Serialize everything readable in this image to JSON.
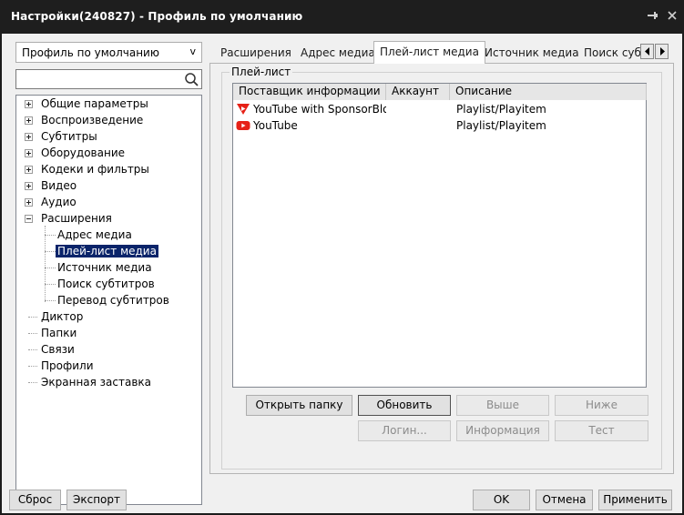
{
  "window": {
    "title": "Настройки(240827) - Профиль по умолчанию",
    "pin_icon": "pin-icon",
    "close_icon": "close-icon"
  },
  "sidebar": {
    "profile_select": {
      "value": "Профиль по умолчанию",
      "arrow": "v"
    },
    "search": {
      "placeholder": "",
      "value": "",
      "icon": "search-icon"
    },
    "tree": [
      {
        "label": "Общие параметры",
        "level": 0,
        "expander": "plus"
      },
      {
        "label": "Воспроизведение",
        "level": 0,
        "expander": "plus"
      },
      {
        "label": "Субтитры",
        "level": 0,
        "expander": "plus"
      },
      {
        "label": "Оборудование",
        "level": 0,
        "expander": "plus"
      },
      {
        "label": "Кодеки и фильтры",
        "level": 0,
        "expander": "plus"
      },
      {
        "label": "Видео",
        "level": 0,
        "expander": "plus"
      },
      {
        "label": "Аудио",
        "level": 0,
        "expander": "plus"
      },
      {
        "label": "Расширения",
        "level": 0,
        "expander": "minus"
      },
      {
        "label": "Адрес медиа",
        "level": 1
      },
      {
        "label": "Плей-лист медиа",
        "level": 1,
        "selected": true
      },
      {
        "label": "Источник медиа",
        "level": 1
      },
      {
        "label": "Поиск субтитров",
        "level": 1
      },
      {
        "label": "Перевод субтитров",
        "level": 1
      },
      {
        "label": "Диктор",
        "level": 0
      },
      {
        "label": "Папки",
        "level": 0
      },
      {
        "label": "Связи",
        "level": 0
      },
      {
        "label": "Профили",
        "level": 0
      },
      {
        "label": "Экранная заставка",
        "level": 0
      }
    ]
  },
  "tabs": {
    "items": [
      "Расширения",
      "Адрес медиа",
      "Плей-лист медиа",
      "Источник медиа",
      "Поиск субт"
    ],
    "active_index": 2,
    "scroll_left_icon": "chevron-left-icon",
    "scroll_right_icon": "chevron-right-icon"
  },
  "playlist": {
    "group_label": "Плей-лист",
    "columns": [
      "Поставщик информации",
      "Аккаунт",
      "Описание"
    ],
    "rows": [
      {
        "icon": "youtube-sponsorblock-icon",
        "provider": "YouTube with SponsorBlo...",
        "account": "",
        "description": "Playlist/Playitem"
      },
      {
        "icon": "youtube-icon",
        "provider": "YouTube",
        "account": "",
        "description": "Playlist/Playitem"
      }
    ],
    "buttons": {
      "open_folder": "Открыть папку",
      "refresh": "Обновить",
      "up": "Выше",
      "down": "Ниже",
      "login": "Логин...",
      "info": "Информация",
      "test": "Тест"
    }
  },
  "footer": {
    "reset": "Сброс",
    "export": "Экспорт",
    "ok": "OK",
    "cancel": "Отмена",
    "apply": "Применить"
  },
  "colors": {
    "title_bar": "#1e1e1e",
    "dialog_bg": "#f0f0f0",
    "selection": "#0a246a",
    "youtube_red": "#e62117"
  }
}
